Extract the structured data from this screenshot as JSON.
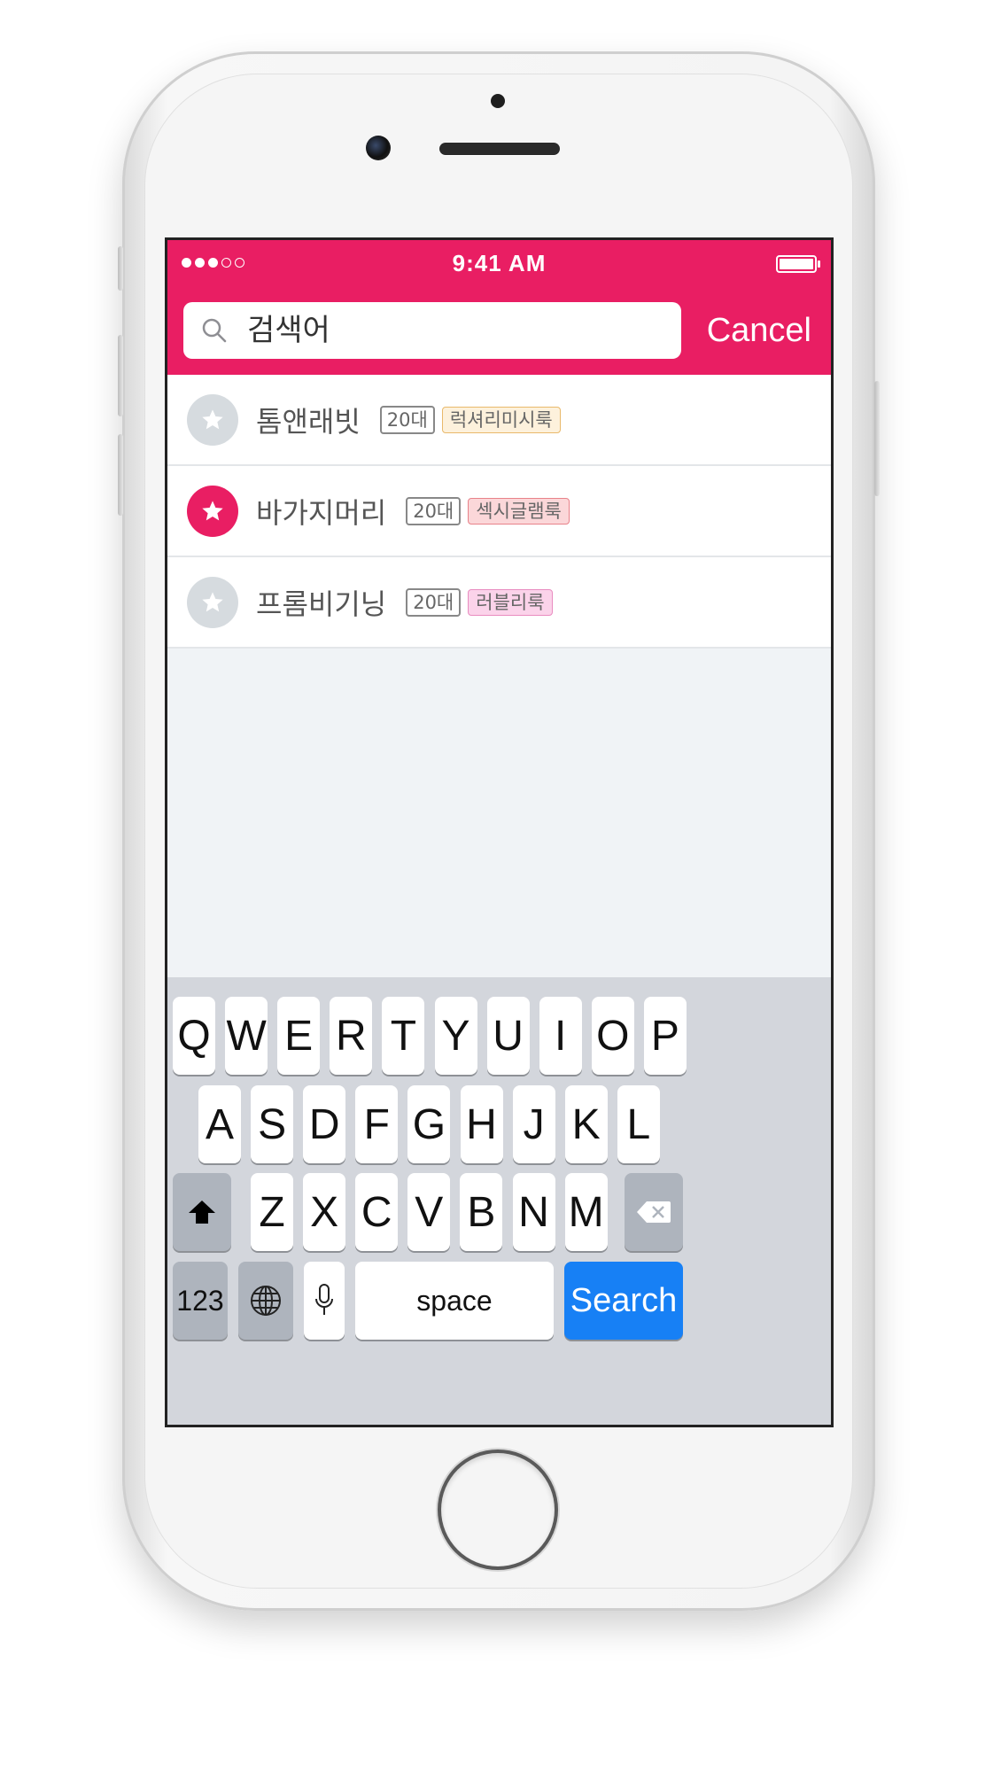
{
  "status_bar": {
    "time": "9:41 AM",
    "signal_bars_filled": 3,
    "signal_bars_total": 5
  },
  "search": {
    "query": "검색어",
    "cancel_label": "Cancel"
  },
  "results": [
    {
      "name": "톰앤래빗",
      "age": "20대",
      "tag": "럭셔리미시룩",
      "tag_bg": "#fdf1dc",
      "tag_border": "#e9b96b",
      "starred": false
    },
    {
      "name": "바가지머리",
      "age": "20대",
      "tag": "섹시글램룩",
      "tag_bg": "#fbd7d9",
      "tag_border": "#e8828a",
      "starred": true
    },
    {
      "name": "프롬비기닝",
      "age": "20대",
      "tag": "러블리룩",
      "tag_bg": "#fbd3ea",
      "tag_border": "#e98cc0",
      "starred": false
    }
  ],
  "keyboard": {
    "row1": [
      "Q",
      "W",
      "E",
      "R",
      "T",
      "Y",
      "U",
      "I",
      "O",
      "P"
    ],
    "row2": [
      "A",
      "S",
      "D",
      "F",
      "G",
      "H",
      "J",
      "K",
      "L"
    ],
    "row3": [
      "Z",
      "X",
      "C",
      "V",
      "B",
      "N",
      "M"
    ],
    "numbers_label": "123",
    "space_label": "space",
    "search_label": "Search"
  },
  "colors": {
    "accent": "#e91e63",
    "search_key": "#1780f5"
  },
  "icons": {
    "search": "search-icon",
    "star": "star-icon",
    "shift": "shift-icon",
    "backspace": "backspace-icon",
    "globe": "globe-icon",
    "mic": "microphone-icon"
  }
}
